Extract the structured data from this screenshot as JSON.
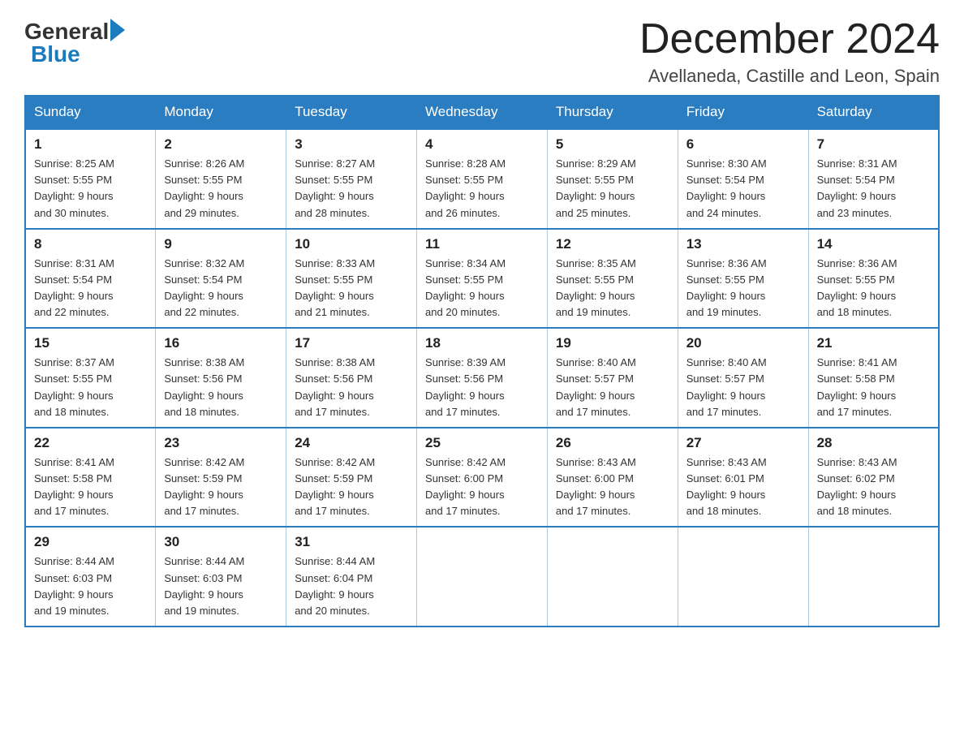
{
  "logo": {
    "general": "General",
    "blue": "Blue",
    "arrow": "▶"
  },
  "title": "December 2024",
  "subtitle": "Avellaneda, Castille and Leon, Spain",
  "days_of_week": [
    "Sunday",
    "Monday",
    "Tuesday",
    "Wednesday",
    "Thursday",
    "Friday",
    "Saturday"
  ],
  "weeks": [
    [
      {
        "num": "1",
        "sunrise": "8:25 AM",
        "sunset": "5:55 PM",
        "daylight": "9 hours and 30 minutes."
      },
      {
        "num": "2",
        "sunrise": "8:26 AM",
        "sunset": "5:55 PM",
        "daylight": "9 hours and 29 minutes."
      },
      {
        "num": "3",
        "sunrise": "8:27 AM",
        "sunset": "5:55 PM",
        "daylight": "9 hours and 28 minutes."
      },
      {
        "num": "4",
        "sunrise": "8:28 AM",
        "sunset": "5:55 PM",
        "daylight": "9 hours and 26 minutes."
      },
      {
        "num": "5",
        "sunrise": "8:29 AM",
        "sunset": "5:55 PM",
        "daylight": "9 hours and 25 minutes."
      },
      {
        "num": "6",
        "sunrise": "8:30 AM",
        "sunset": "5:54 PM",
        "daylight": "9 hours and 24 minutes."
      },
      {
        "num": "7",
        "sunrise": "8:31 AM",
        "sunset": "5:54 PM",
        "daylight": "9 hours and 23 minutes."
      }
    ],
    [
      {
        "num": "8",
        "sunrise": "8:31 AM",
        "sunset": "5:54 PM",
        "daylight": "9 hours and 22 minutes."
      },
      {
        "num": "9",
        "sunrise": "8:32 AM",
        "sunset": "5:54 PM",
        "daylight": "9 hours and 22 minutes."
      },
      {
        "num": "10",
        "sunrise": "8:33 AM",
        "sunset": "5:55 PM",
        "daylight": "9 hours and 21 minutes."
      },
      {
        "num": "11",
        "sunrise": "8:34 AM",
        "sunset": "5:55 PM",
        "daylight": "9 hours and 20 minutes."
      },
      {
        "num": "12",
        "sunrise": "8:35 AM",
        "sunset": "5:55 PM",
        "daylight": "9 hours and 19 minutes."
      },
      {
        "num": "13",
        "sunrise": "8:36 AM",
        "sunset": "5:55 PM",
        "daylight": "9 hours and 19 minutes."
      },
      {
        "num": "14",
        "sunrise": "8:36 AM",
        "sunset": "5:55 PM",
        "daylight": "9 hours and 18 minutes."
      }
    ],
    [
      {
        "num": "15",
        "sunrise": "8:37 AM",
        "sunset": "5:55 PM",
        "daylight": "9 hours and 18 minutes."
      },
      {
        "num": "16",
        "sunrise": "8:38 AM",
        "sunset": "5:56 PM",
        "daylight": "9 hours and 18 minutes."
      },
      {
        "num": "17",
        "sunrise": "8:38 AM",
        "sunset": "5:56 PM",
        "daylight": "9 hours and 17 minutes."
      },
      {
        "num": "18",
        "sunrise": "8:39 AM",
        "sunset": "5:56 PM",
        "daylight": "9 hours and 17 minutes."
      },
      {
        "num": "19",
        "sunrise": "8:40 AM",
        "sunset": "5:57 PM",
        "daylight": "9 hours and 17 minutes."
      },
      {
        "num": "20",
        "sunrise": "8:40 AM",
        "sunset": "5:57 PM",
        "daylight": "9 hours and 17 minutes."
      },
      {
        "num": "21",
        "sunrise": "8:41 AM",
        "sunset": "5:58 PM",
        "daylight": "9 hours and 17 minutes."
      }
    ],
    [
      {
        "num": "22",
        "sunrise": "8:41 AM",
        "sunset": "5:58 PM",
        "daylight": "9 hours and 17 minutes."
      },
      {
        "num": "23",
        "sunrise": "8:42 AM",
        "sunset": "5:59 PM",
        "daylight": "9 hours and 17 minutes."
      },
      {
        "num": "24",
        "sunrise": "8:42 AM",
        "sunset": "5:59 PM",
        "daylight": "9 hours and 17 minutes."
      },
      {
        "num": "25",
        "sunrise": "8:42 AM",
        "sunset": "6:00 PM",
        "daylight": "9 hours and 17 minutes."
      },
      {
        "num": "26",
        "sunrise": "8:43 AM",
        "sunset": "6:00 PM",
        "daylight": "9 hours and 17 minutes."
      },
      {
        "num": "27",
        "sunrise": "8:43 AM",
        "sunset": "6:01 PM",
        "daylight": "9 hours and 18 minutes."
      },
      {
        "num": "28",
        "sunrise": "8:43 AM",
        "sunset": "6:02 PM",
        "daylight": "9 hours and 18 minutes."
      }
    ],
    [
      {
        "num": "29",
        "sunrise": "8:44 AM",
        "sunset": "6:03 PM",
        "daylight": "9 hours and 19 minutes."
      },
      {
        "num": "30",
        "sunrise": "8:44 AM",
        "sunset": "6:03 PM",
        "daylight": "9 hours and 19 minutes."
      },
      {
        "num": "31",
        "sunrise": "8:44 AM",
        "sunset": "6:04 PM",
        "daylight": "9 hours and 20 minutes."
      },
      null,
      null,
      null,
      null
    ]
  ]
}
